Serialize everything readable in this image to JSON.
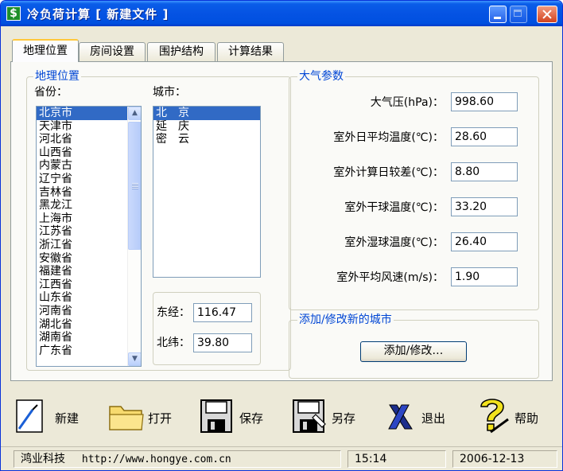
{
  "window": {
    "title": "冷负荷计算 [ 新建文件 ]"
  },
  "tabs": [
    "地理位置",
    "房间设置",
    "围护结构",
    "计算结果"
  ],
  "location": {
    "group_title": "地理位置",
    "province_label": "省份：",
    "city_label": "城市：",
    "provinces": [
      "北京市",
      "天津市",
      "河北省",
      "山西省",
      "内蒙古",
      "辽宁省",
      "吉林省",
      "黑龙江",
      "上海市",
      "江苏省",
      "浙江省",
      "安徽省",
      "福建省",
      "江西省",
      "山东省",
      "河南省",
      "湖北省",
      "湖南省",
      "广东省"
    ],
    "selected_province": "北京市",
    "cities": [
      "北　京",
      "延　庆",
      "密　云"
    ],
    "selected_city": "北　京",
    "longitude_label": "东经：",
    "longitude": "116.47",
    "latitude_label": "北纬：",
    "latitude": "39.80"
  },
  "atmosphere": {
    "group_title": "大气参数",
    "params": [
      {
        "label": "大气压(hPa)：",
        "value": "998.60"
      },
      {
        "label": "室外日平均温度(℃)：",
        "value": "28.60"
      },
      {
        "label": "室外计算日较差(℃)：",
        "value": "8.80"
      },
      {
        "label": "室外干球温度(℃)：",
        "value": "33.20"
      },
      {
        "label": "室外湿球温度(℃)：",
        "value": "26.40"
      },
      {
        "label": "室外平均风速(m/s)：",
        "value": "1.90"
      }
    ]
  },
  "city_edit": {
    "group_title": "添加/修改新的城市",
    "button_label": "添加/修改…"
  },
  "toolbar": {
    "new": "新建",
    "open": "打开",
    "save": "保存",
    "save_as": "另存",
    "exit": "退出",
    "help": "帮助"
  },
  "status": {
    "company": "鸿业科技",
    "url": "http://www.hongye.com.cn",
    "time": "15:14",
    "date": "2006-12-13"
  },
  "colors": {
    "title_bar": "#0553e3",
    "selection": "#316ac5",
    "group_title": "#0046d5",
    "face": "#ece9d8"
  }
}
